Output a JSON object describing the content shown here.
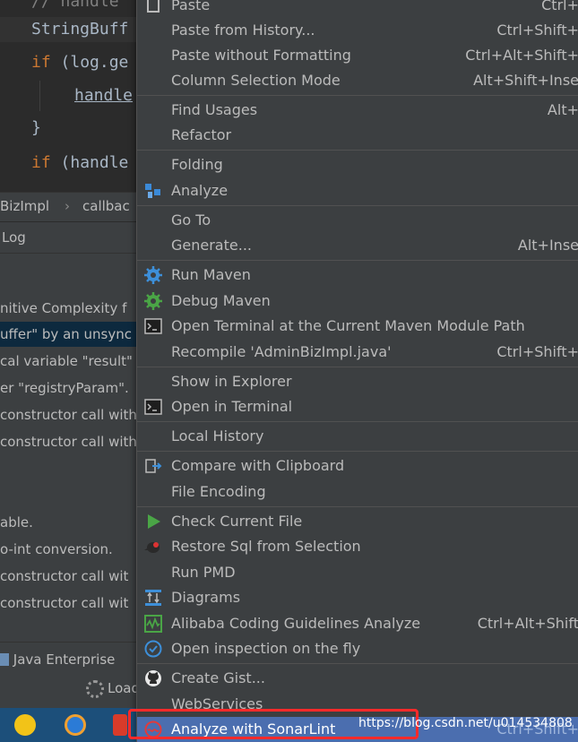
{
  "editor": {
    "lines": [
      {
        "text": "// handle"
      },
      {
        "text": "StringBuff"
      },
      {
        "kw": "if",
        "text": " (log.ge"
      },
      {
        "fn": "handle"
      },
      {
        "text": "}"
      },
      {
        "kw": "if",
        "text": " (handle"
      }
    ]
  },
  "breadcrumb": {
    "item1": "BizImpl",
    "sep": "›",
    "item2": "callbac"
  },
  "log_panel": {
    "title": "Log"
  },
  "log_lines": [
    "nitive Complexity f",
    "uffer\" by an unsync",
    "cal variable \"result\"",
    "er \"registryParam\".",
    "constructor call with",
    "constructor call with",
    "able.",
    "o-int conversion.",
    "constructor call wit",
    "constructor call wit"
  ],
  "bottom": {
    "tab_java_enterprise": "Java Enterprise",
    "loading": "Load"
  },
  "menu": {
    "items": [
      {
        "label": "Paste",
        "shortcut": "Ctrl+",
        "icon": "paste-icon"
      },
      {
        "label": "Paste from History...",
        "shortcut": "Ctrl+Shift+"
      },
      {
        "label": "Paste without Formatting",
        "shortcut": "Ctrl+Alt+Shift+"
      },
      {
        "label": "Column Selection Mode",
        "shortcut": "Alt+Shift+Inse"
      },
      {
        "label": "Find Usages",
        "shortcut": "Alt+"
      },
      {
        "label": "Refactor",
        "shortcut": ""
      },
      {
        "label": "Folding",
        "shortcut": ""
      },
      {
        "label": "Analyze",
        "shortcut": "",
        "icon": "analyze-icon"
      },
      {
        "label": "Go To",
        "shortcut": ""
      },
      {
        "label": "Generate...",
        "shortcut": "Alt+Inse"
      },
      {
        "label": "Run Maven",
        "shortcut": "",
        "icon": "gear-icon"
      },
      {
        "label": "Debug Maven",
        "shortcut": "",
        "icon": "gear-debug-icon"
      },
      {
        "label": "Open Terminal at the Current Maven Module Path",
        "shortcut": "",
        "icon": "terminal-icon"
      },
      {
        "label": "Recompile 'AdminBizImpl.java'",
        "shortcut": "Ctrl+Shift+"
      },
      {
        "label": "Show in Explorer",
        "shortcut": ""
      },
      {
        "label": "Open in Terminal",
        "shortcut": "",
        "icon": "terminal-icon"
      },
      {
        "label": "Local History",
        "shortcut": ""
      },
      {
        "label": "Compare with Clipboard",
        "shortcut": "",
        "icon": "compare-icon"
      },
      {
        "label": "File Encoding",
        "shortcut": ""
      },
      {
        "label": "Check Current File",
        "shortcut": "",
        "icon": "play-icon"
      },
      {
        "label": "Restore Sql from Selection",
        "shortcut": "",
        "icon": "mybatis-bird-icon"
      },
      {
        "label": "Run PMD",
        "shortcut": ""
      },
      {
        "label": "Diagrams",
        "shortcut": "",
        "icon": "diagram-icon"
      },
      {
        "label": "Alibaba Coding Guidelines Analyze",
        "shortcut": "Ctrl+Alt+Shift",
        "icon": "alibaba-analyze-icon"
      },
      {
        "label": "Open inspection on the fly",
        "shortcut": "",
        "icon": "check-circle-icon"
      },
      {
        "label": "Create Gist...",
        "shortcut": "",
        "icon": "github-icon"
      },
      {
        "label": "WebServices",
        "shortcut": ""
      },
      {
        "label": "Analyze with SonarLint",
        "shortcut": "Ctrl+Shift+",
        "icon": "sonarlint-icon"
      }
    ]
  },
  "watermark": "https://blog.csdn.net/u014534808",
  "colors": {
    "menu_bg": "#3c3f41",
    "selection": "#4b6eaf",
    "highlight_border": "#ff2a2a",
    "editor_bg": "#2b2b2b"
  }
}
